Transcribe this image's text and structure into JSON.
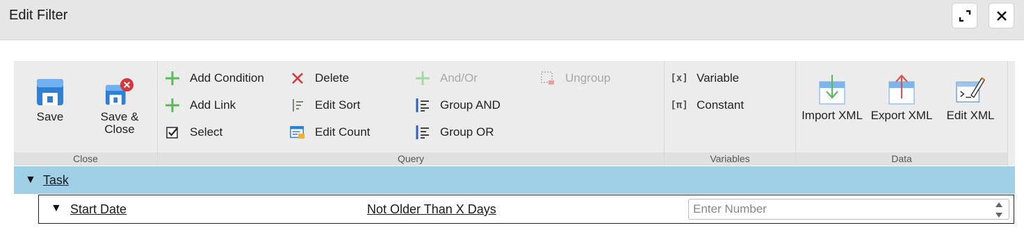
{
  "window": {
    "title": "Edit Filter"
  },
  "ribbon": {
    "groups": {
      "close": "Close",
      "query": "Query",
      "variables": "Variables",
      "data": "Data"
    },
    "close": {
      "save": "Save",
      "save_close": "Save &\nClose"
    },
    "query": {
      "add_condition": "Add Condition",
      "add_link": "Add Link",
      "select": "Select",
      "delete": "Delete",
      "edit_sort": "Edit Sort",
      "edit_count": "Edit Count",
      "and_or": "And/Or",
      "group_and": "Group AND",
      "group_or": "Group OR",
      "ungroup": "Ungroup"
    },
    "variables": {
      "variable": "Variable",
      "variable_glyph": "[x]",
      "constant": "Constant",
      "constant_glyph": "[π]"
    },
    "data": {
      "import_xml": "Import XML",
      "export_xml": "Export XML",
      "edit_xml": "Edit XML"
    }
  },
  "tree": {
    "entity": "Task",
    "conditions": [
      {
        "field": "Start Date",
        "operator": "Not Older Than X Days",
        "placeholder": "Enter Number",
        "value": ""
      }
    ]
  },
  "colors": {
    "task_row": "#9fd0e6",
    "ribbon": "#ececec",
    "accent_green": "#5cb85c",
    "delete_red": "#d9534f",
    "icon_blue": "#2f7fd8"
  },
  "icons": {
    "maximize": "expand-icon",
    "close": "close-icon",
    "save": "floppy-icon",
    "save_close": "floppy-close-icon",
    "add_condition": "plus-icon",
    "add_link": "plus-icon",
    "select": "checkbox-icon",
    "delete": "x-icon",
    "edit_sort": "sort-icon",
    "edit_count": "count-icon",
    "and_or": "plus-icon",
    "group_and": "group-icon",
    "group_or": "group-icon",
    "ungroup": "ungroup-icon",
    "import_xml": "import-icon",
    "export_xml": "export-icon",
    "edit_xml": "edit-xml-icon"
  }
}
